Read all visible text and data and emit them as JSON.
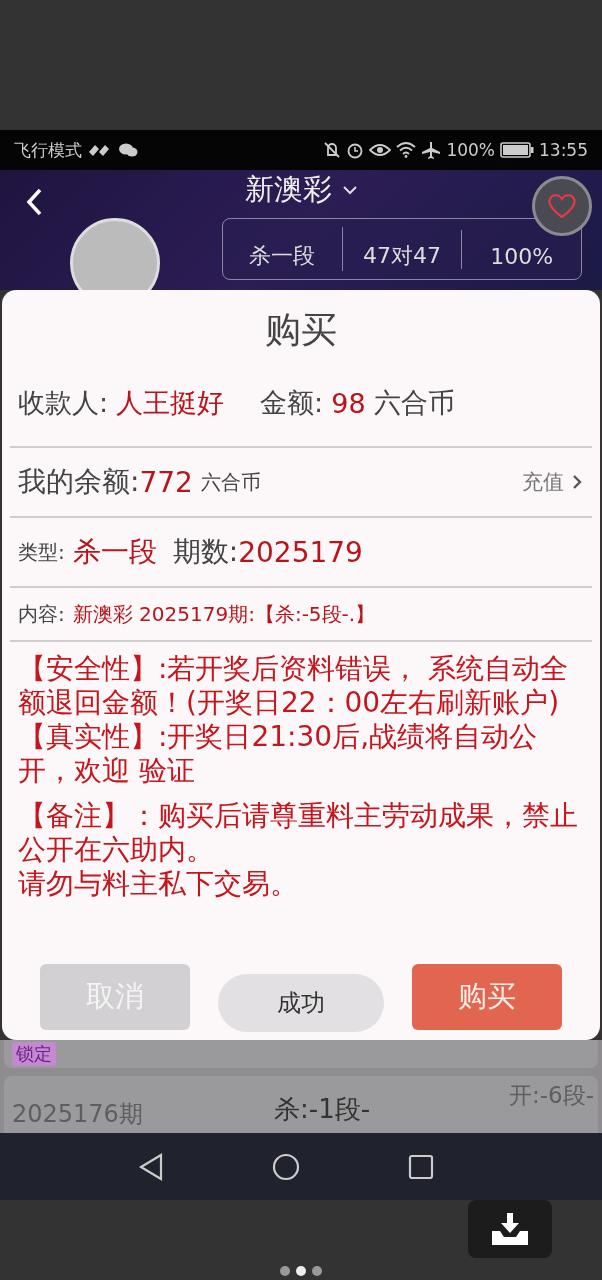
{
  "status_bar": {
    "mode": "飞行模式",
    "battery": "100%",
    "time": "13:55"
  },
  "header": {
    "title": "新澳彩",
    "stats": [
      "杀一段",
      "47对47",
      "100%"
    ]
  },
  "dialog": {
    "title": "购买",
    "payee_label": "收款人:",
    "payee": "人王挺好",
    "amount_label": "金额:",
    "amount": "98",
    "amount_unit": "六合币",
    "balance_label": "我的余额:",
    "balance": "772",
    "balance_unit": "六合币",
    "recharge": "充值",
    "type_label": "类型:",
    "type": "杀一段",
    "period_label": "期数:",
    "period": "2025179",
    "content_label": "内容:",
    "content": "新澳彩 2025179期:【杀:-5段-.】",
    "notices": [
      "【安全性】:若开奖后资料错误， 系统自动全额退回金额！(开奖日22：00左右刷新账户)",
      "【真实性】:开奖日21:30后,战绩将自动公开，欢迎 验证",
      "【备注】：购买后请尊重料主劳动成果，禁止公开在六助内。",
      "请勿与料主私下交易。"
    ],
    "buttons": [
      {
        "label": "取消",
        "kind": "cancel"
      },
      {
        "label": "成功",
        "kind": "neutral"
      },
      {
        "label": "购买",
        "kind": "primary"
      }
    ]
  },
  "list": {
    "tag": "锁定",
    "period": "2025176期",
    "pick": "杀:-1段-",
    "result": "开:-6段-"
  },
  "pager": [
    {
      "selected": false
    },
    {
      "selected": true
    },
    {
      "selected": false
    }
  ]
}
